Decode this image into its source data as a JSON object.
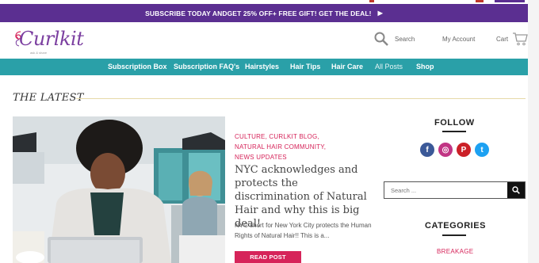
{
  "promo": {
    "text_pre": "SUBSCRIBE TODAY AND ",
    "text_bold": "GET 25% OFF",
    "text_post": " + FREE GIFT! GET THE DEAL!",
    "arrow": "▶"
  },
  "header": {
    "logo_text": "Curlkit",
    "logo_tag": "ask & share",
    "search_label": "Search",
    "account_label": "My Account",
    "cart_label": "Cart"
  },
  "nav": {
    "items": [
      {
        "label": "Subscription Box"
      },
      {
        "label": "Subscription FAQ's"
      },
      {
        "label": "Hairstyles"
      },
      {
        "label": "Hair Tips"
      },
      {
        "label": "Hair Care"
      },
      {
        "label": "All Posts"
      },
      {
        "label": "Shop"
      }
    ]
  },
  "main": {
    "section_title": "THE LATEST",
    "post": {
      "categories_line1": "CULTURE, CURLKIT BLOG,",
      "categories_line2": "NATURAL HAIR COMMUNITY,",
      "categories_line3": "NEWS UPDATES",
      "title": "NYC acknowledges and protects the discrimination of Natural Hair and why this is big deal!",
      "excerpt": "NYC short for New York City protects the Human Rights of Natural Hair!! This is a...",
      "read_more": "READ POST"
    }
  },
  "sidebar": {
    "follow_title": "FOLLOW",
    "social": [
      {
        "icon": "facebook-icon",
        "glyph": "f",
        "color": "#3b5998"
      },
      {
        "icon": "instagram-icon",
        "glyph": "◎",
        "color": "#c13584"
      },
      {
        "icon": "pinterest-icon",
        "glyph": "P",
        "color": "#cb2027"
      },
      {
        "icon": "twitter-icon",
        "glyph": "t",
        "color": "#1da1f2"
      }
    ],
    "search_placeholder": "Search ...",
    "categories_title": "CATEGORIES",
    "category_first": "BREAKAGE"
  },
  "colors": {
    "promo_bg": "#5b2f91",
    "nav_bg": "#2aa0a8",
    "accent_pink": "#d6245a",
    "logo_purple": "#7b3fa0"
  }
}
